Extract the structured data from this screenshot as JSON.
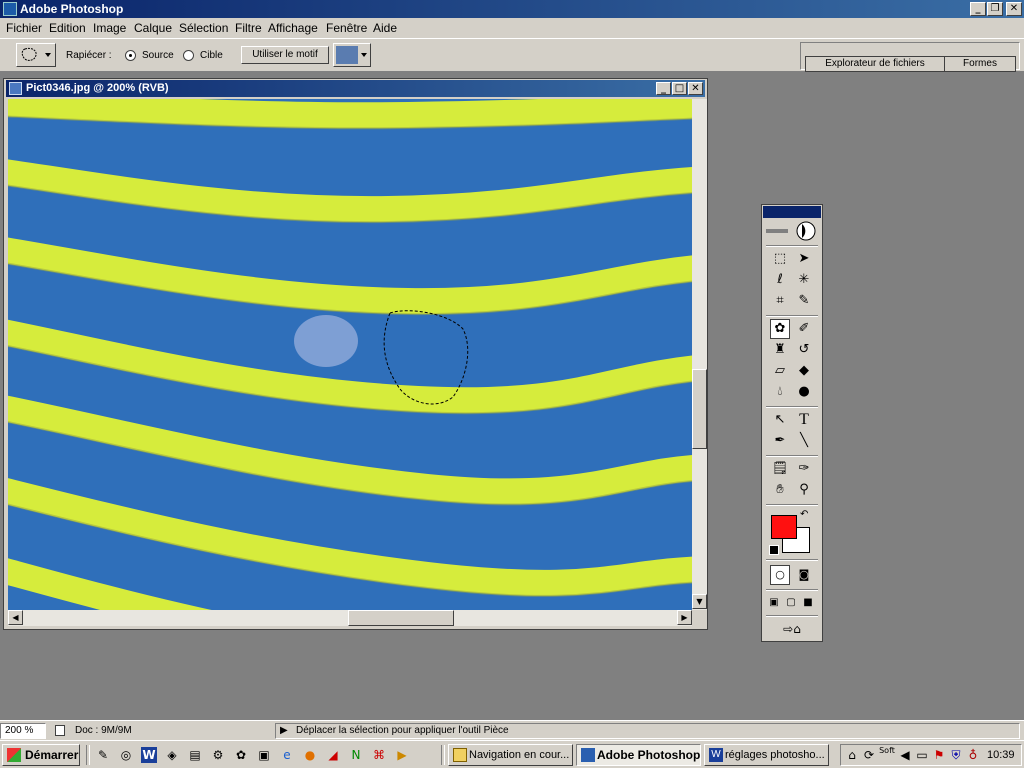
{
  "app": {
    "title": "Adobe Photoshop"
  },
  "menu": [
    "Fichier",
    "Edition",
    "Image",
    "Calque",
    "Sélection",
    "Filtre",
    "Affichage",
    "Fenêtre",
    "Aide"
  ],
  "options": {
    "patch_label": "Rapiécer :",
    "source_label": "Source",
    "target_label": "Cible",
    "source_selected": true,
    "use_pattern_label": "Utiliser le motif",
    "tabs": [
      "Explorateur de fichiers",
      "Formes"
    ]
  },
  "document": {
    "title": "Pict0346.jpg @ 200% (RVB)"
  },
  "toolbox": {
    "tools": [
      "marquee-tool",
      "move-tool",
      "lasso-tool",
      "magic-wand-tool",
      "crop-tool",
      "slice-tool",
      "patch-tool",
      "brush-tool",
      "stamp-tool",
      "history-brush-tool",
      "eraser-tool",
      "paint-bucket-tool",
      "blur-tool",
      "dodge-tool",
      "path-select-tool",
      "type-tool",
      "pen-tool",
      "line-tool",
      "notes-tool",
      "eyedropper-tool",
      "hand-tool",
      "zoom-tool"
    ],
    "type_glyph": "T",
    "foreground_color": "#ff1010",
    "background_color": "#ffffff"
  },
  "status": {
    "zoom": "200 %",
    "doc_size": "Doc : 9M/9M",
    "hint": "Déplacer la sélection pour appliquer l'outil Pièce"
  },
  "taskbar": {
    "start_label": "Démarrer",
    "tasks": [
      "Navigation en cour...",
      "Adobe Photoshop",
      "réglages photosho..."
    ],
    "active_task": "Adobe Photoshop",
    "tray_label": "Soft",
    "clock": "10:39"
  },
  "colors": {
    "title_active": "#0a246a",
    "stripe_blue": "#2f6fba",
    "stripe_yellow": "#d6ec3c"
  }
}
